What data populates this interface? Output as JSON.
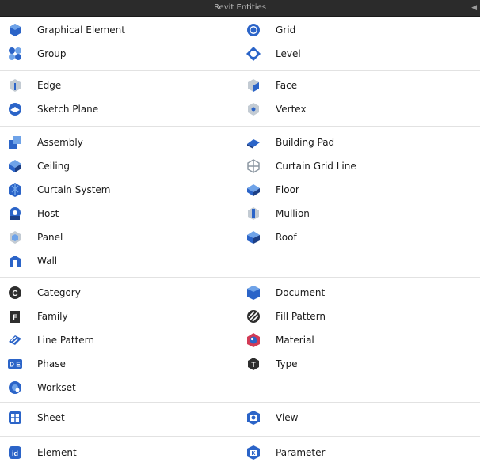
{
  "window": {
    "title": "Revit Entities"
  },
  "groups": [
    {
      "items": [
        {
          "label": "Graphical Element",
          "icon": "graphical-element-icon"
        },
        {
          "label": "Grid",
          "icon": "grid-icon"
        },
        {
          "label": "Group",
          "icon": "group-icon"
        },
        {
          "label": "Level",
          "icon": "level-icon"
        }
      ]
    },
    {
      "items": [
        {
          "label": "Edge",
          "icon": "edge-icon"
        },
        {
          "label": "Face",
          "icon": "face-icon"
        },
        {
          "label": "Sketch Plane",
          "icon": "sketch-plane-icon"
        },
        {
          "label": "Vertex",
          "icon": "vertex-icon"
        }
      ]
    },
    {
      "items": [
        {
          "label": "Assembly",
          "icon": "assembly-icon"
        },
        {
          "label": "Building Pad",
          "icon": "building-pad-icon"
        },
        {
          "label": "Ceiling",
          "icon": "ceiling-icon"
        },
        {
          "label": "Curtain Grid Line",
          "icon": "curtain-grid-line-icon"
        },
        {
          "label": "Curtain System",
          "icon": "curtain-system-icon"
        },
        {
          "label": "Floor",
          "icon": "floor-icon"
        },
        {
          "label": "Host",
          "icon": "host-icon"
        },
        {
          "label": "Mullion",
          "icon": "mullion-icon"
        },
        {
          "label": "Panel",
          "icon": "panel-icon"
        },
        {
          "label": "Roof",
          "icon": "roof-icon"
        },
        {
          "label": "Wall",
          "icon": "wall-icon"
        }
      ]
    },
    {
      "items": [
        {
          "label": "Category",
          "icon": "category-icon"
        },
        {
          "label": "Document",
          "icon": "document-icon"
        },
        {
          "label": "Family",
          "icon": "family-icon"
        },
        {
          "label": "Fill Pattern",
          "icon": "fill-pattern-icon"
        },
        {
          "label": "Line Pattern",
          "icon": "line-pattern-icon"
        },
        {
          "label": "Material",
          "icon": "material-icon"
        },
        {
          "label": "Phase",
          "icon": "phase-icon"
        },
        {
          "label": "Type",
          "icon": "type-icon"
        },
        {
          "label": "Workset",
          "icon": "workset-icon"
        }
      ]
    },
    {
      "items": [
        {
          "label": "Sheet",
          "icon": "sheet-icon"
        },
        {
          "label": "View",
          "icon": "view-icon"
        }
      ]
    },
    {
      "items": [
        {
          "label": "Element",
          "icon": "element-icon"
        },
        {
          "label": "Parameter",
          "icon": "parameter-icon"
        }
      ]
    }
  ],
  "colors": {
    "accent_blue": "#2b64c8",
    "light_blue": "#6fa3e8",
    "gray": "#9aa6b2",
    "dark": "#333333",
    "titlebar": "#2b2b2b"
  }
}
